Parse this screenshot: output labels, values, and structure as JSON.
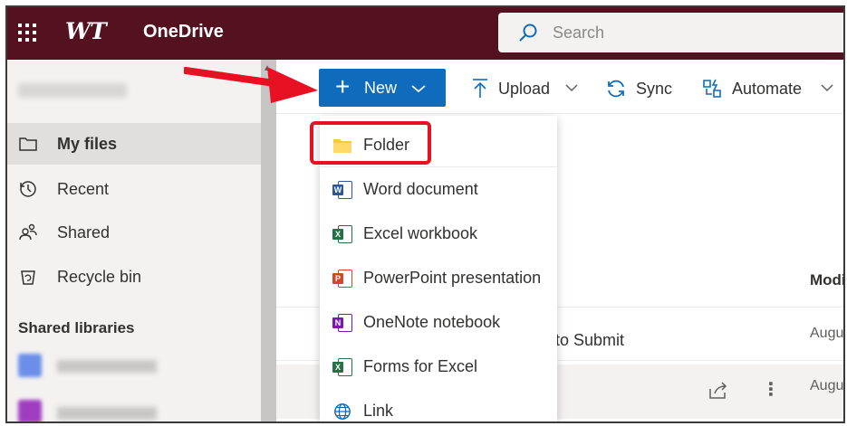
{
  "app": {
    "brand": "WT",
    "name": "OneDrive"
  },
  "search": {
    "placeholder": "Search"
  },
  "sidebar": {
    "user_name": "",
    "items": [
      {
        "label": "My files",
        "icon": "folder-icon",
        "active": true
      },
      {
        "label": "Recent",
        "icon": "clock-icon",
        "active": false
      },
      {
        "label": "Shared",
        "icon": "people-icon",
        "active": false
      },
      {
        "label": "Recycle bin",
        "icon": "recycle-bin-icon",
        "active": false
      }
    ],
    "shared_libraries_heading": "Shared libraries"
  },
  "toolbar": {
    "new_label": "New",
    "upload_label": "Upload",
    "sync_label": "Sync",
    "automate_label": "Automate"
  },
  "new_menu": {
    "items": [
      {
        "label": "Folder",
        "icon": "folder-icon"
      },
      {
        "label": "Word document",
        "icon": "word-icon"
      },
      {
        "label": "Excel workbook",
        "icon": "excel-icon"
      },
      {
        "label": "PowerPoint presentation",
        "icon": "powerpoint-icon"
      },
      {
        "label": "OneNote notebook",
        "icon": "onenote-icon"
      },
      {
        "label": "Forms for Excel",
        "icon": "forms-excel-icon"
      },
      {
        "label": "Link",
        "icon": "globe-icon"
      }
    ]
  },
  "file_list": {
    "modified_header": "Modi",
    "rows": [
      {
        "name_fragment": "to Submit",
        "modified": "Augus"
      },
      {
        "name_fragment": "",
        "modified": "Augus"
      }
    ]
  },
  "colors": {
    "topbar": "#54111f",
    "accent": "#0f6cbd",
    "highlight": "#e81123"
  }
}
